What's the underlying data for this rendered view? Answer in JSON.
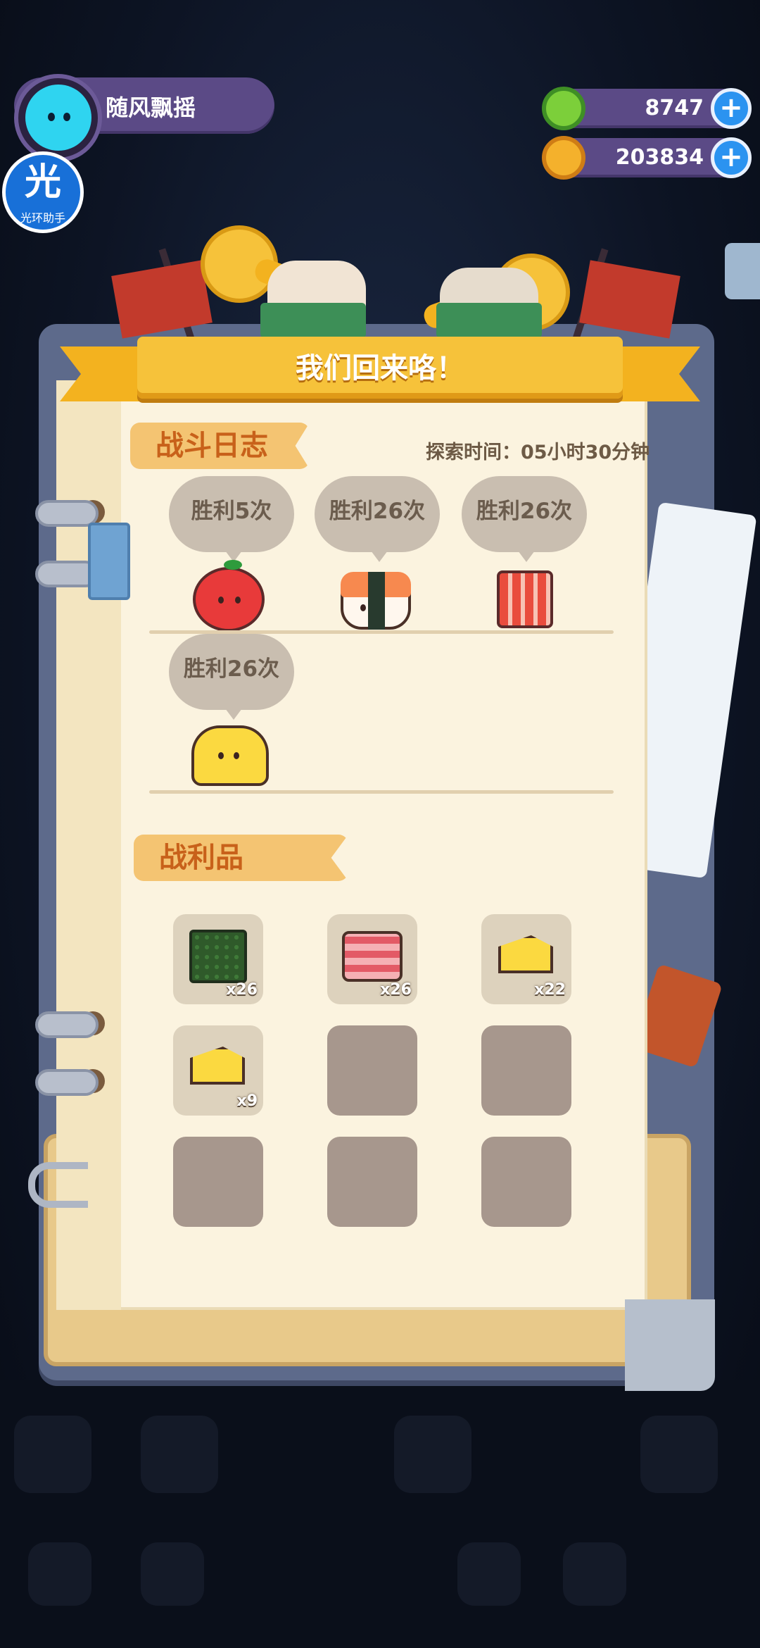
{
  "header": {
    "username": "随风飘摇",
    "helper_badge": {
      "main": "光",
      "caption": "光环助手"
    },
    "resources": [
      {
        "name": "green-currency",
        "value": "8747",
        "icon": "green-coin-icon"
      },
      {
        "name": "gold-currency",
        "value": "203834",
        "icon": "planet-coin-icon"
      }
    ]
  },
  "banner": {
    "title": "我们回来咯！"
  },
  "battle_log": {
    "title": "战斗日志",
    "explore_time": "探索时间：05小时30分钟",
    "entries": [
      {
        "label": "胜利5次",
        "icon": "apple-icon"
      },
      {
        "label": "胜利26次",
        "icon": "sushi-icon"
      },
      {
        "label": "胜利26次",
        "icon": "bacon-icon"
      },
      {
        "label": "胜利26次",
        "icon": "cheese-monster-icon"
      }
    ]
  },
  "loot": {
    "title": "战利品",
    "items": [
      {
        "icon": "seaweed-icon",
        "qty": "x26"
      },
      {
        "icon": "meat-icon",
        "qty": "x26"
      },
      {
        "icon": "cheese-icon",
        "qty": "x22"
      },
      {
        "icon": "cheese-icon",
        "qty": "x9"
      },
      {
        "icon": null,
        "qty": ""
      },
      {
        "icon": null,
        "qty": ""
      },
      {
        "icon": null,
        "qty": ""
      },
      {
        "icon": null,
        "qty": ""
      },
      {
        "icon": null,
        "qty": ""
      }
    ]
  },
  "colors": {
    "ribbon": "#f6c23a",
    "paper": "#fbf3df",
    "tag": "#f4c472",
    "tag_text": "#c8611a",
    "bubble": "#c9beb0",
    "empty_slot": "#a7978d",
    "pill": "#5b4a86",
    "plus": "#2b93f0"
  }
}
